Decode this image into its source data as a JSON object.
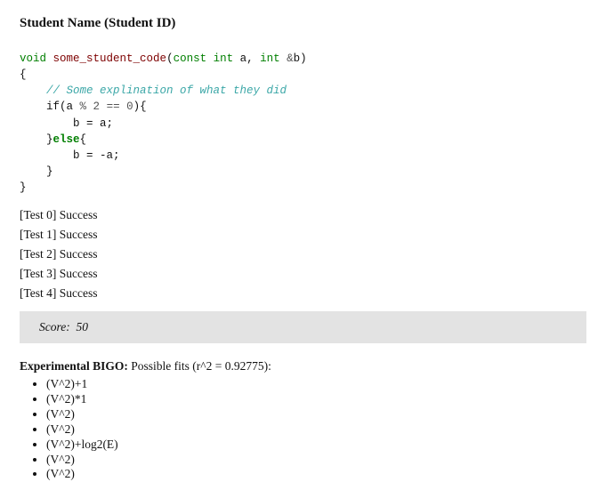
{
  "header": {
    "title": "Student Name (Student ID)"
  },
  "code": {
    "kw_void": "void",
    "func_name": "some_student_code",
    "open_paren": "(",
    "kw_const_int": "const int",
    "param_a": " a, ",
    "kw_int": "int",
    "amp": " &",
    "param_b": "b",
    "close_paren_nl": ")",
    "brace_open": "{",
    "indent1": "    ",
    "comment": "// Some explination of what they did",
    "if_line_pre": "    if(a ",
    "if_mod": "%",
    "if_sp1": " ",
    "if_two": "2",
    "if_sp2": " ",
    "if_eq": "==",
    "if_sp3": " ",
    "if_zero": "0",
    "if_tail": "){",
    "assign1": "        b = a;",
    "else_pre": "    }",
    "else_kw": "else",
    "else_post": "{",
    "assign2": "        b = -a;",
    "inner_close": "    }",
    "brace_close": "}"
  },
  "tests": [
    {
      "label": "[Test 0]",
      "result": "Success"
    },
    {
      "label": "[Test 1]",
      "result": "Success"
    },
    {
      "label": "[Test 2]",
      "result": "Success"
    },
    {
      "label": "[Test 3]",
      "result": "Success"
    },
    {
      "label": "[Test 4]",
      "result": "Success"
    }
  ],
  "score": {
    "label": "Score:",
    "value": "50"
  },
  "bigo": {
    "heading_bold": "Experimental BIGO:",
    "heading_rest": " Possible fits (r^2 = 0.92775):",
    "fits": [
      "(V^2)+1",
      "(V^2)*1",
      "(V^2)",
      "(V^2)",
      "(V^2)+log2(E)",
      "(V^2)",
      "(V^2)"
    ]
  }
}
